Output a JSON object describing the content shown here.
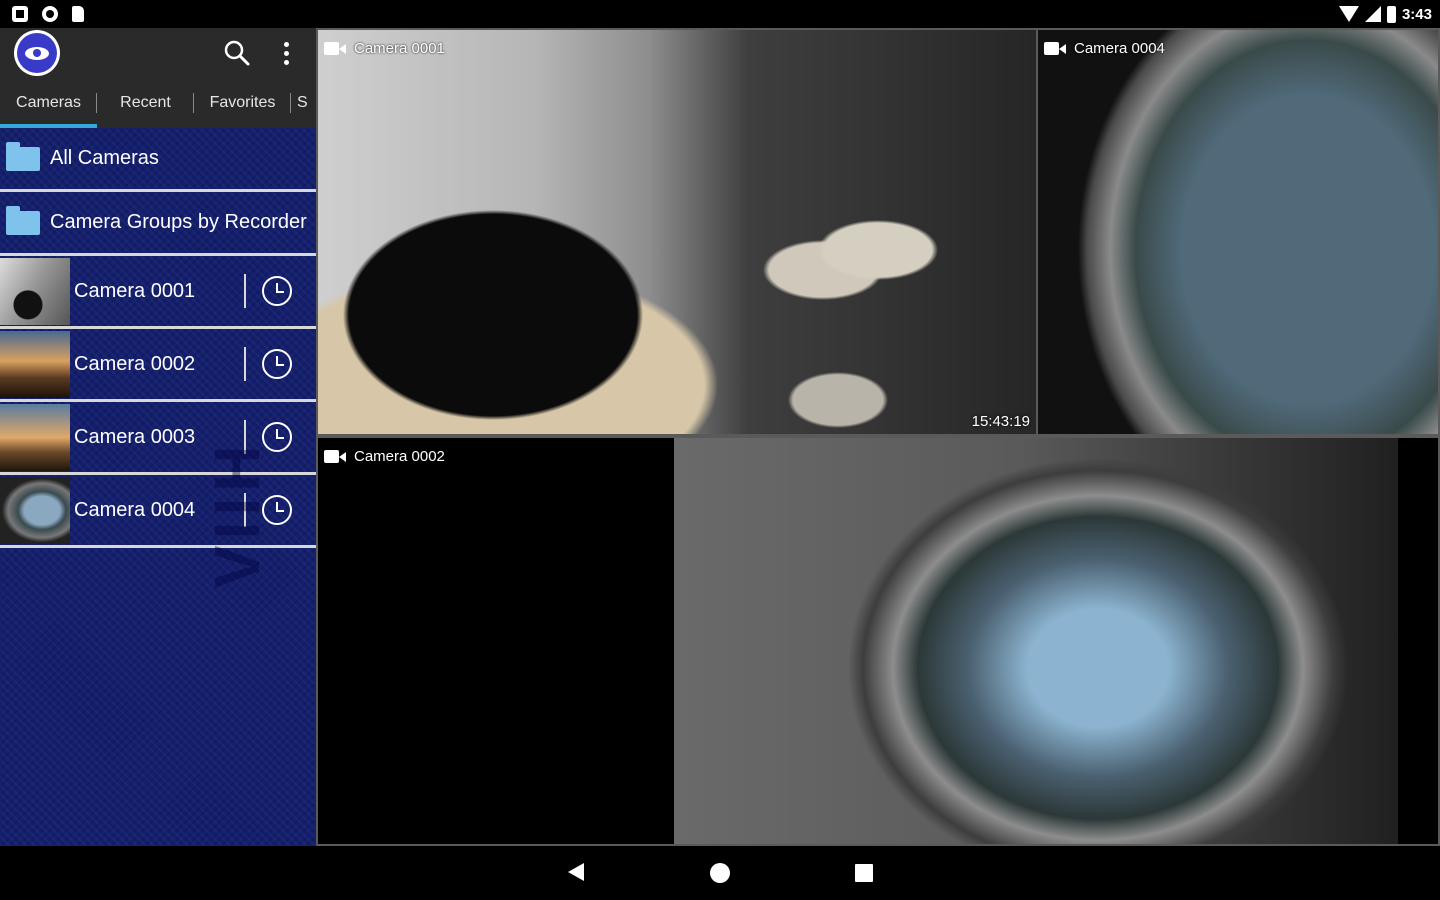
{
  "status_bar": {
    "time": "3:43"
  },
  "app": {
    "logo_icon": "eye-icon",
    "search_icon": "search-icon",
    "menu_icon": "more-vert-icon"
  },
  "tabs": [
    {
      "label": "Cameras",
      "active": true
    },
    {
      "label": "Recent",
      "active": false
    },
    {
      "label": "Favorites",
      "active": false
    },
    {
      "label": "S",
      "active": false
    }
  ],
  "folders": [
    {
      "label": "All Cameras"
    },
    {
      "label": "Camera Groups by Recorder"
    }
  ],
  "cameras": [
    {
      "label": "Camera 0001"
    },
    {
      "label": "Camera 0002"
    },
    {
      "label": "Camera 0003"
    },
    {
      "label": "Camera 0004"
    }
  ],
  "watermark": "VIIH",
  "views": [
    {
      "label": "Camera 0001",
      "timestamp": "15:43:19"
    },
    {
      "label": "Camera 0004"
    },
    {
      "label": "Camera 0002"
    }
  ],
  "colors": {
    "panel": "#141f6e",
    "accent": "#36a8d8",
    "bar": "#2a2a2a"
  }
}
